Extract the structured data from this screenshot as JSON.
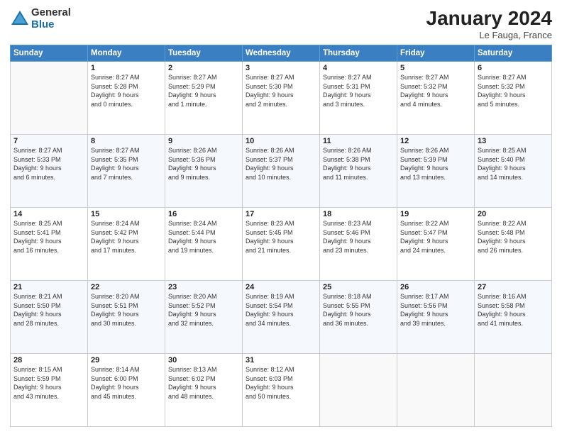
{
  "header": {
    "logo_general": "General",
    "logo_blue": "Blue",
    "month_title": "January 2024",
    "location": "Le Fauga, France"
  },
  "days_of_week": [
    "Sunday",
    "Monday",
    "Tuesday",
    "Wednesday",
    "Thursday",
    "Friday",
    "Saturday"
  ],
  "weeks": [
    [
      {
        "day": "",
        "content": ""
      },
      {
        "day": "1",
        "content": "Sunrise: 8:27 AM\nSunset: 5:28 PM\nDaylight: 9 hours\nand 0 minutes."
      },
      {
        "day": "2",
        "content": "Sunrise: 8:27 AM\nSunset: 5:29 PM\nDaylight: 9 hours\nand 1 minute."
      },
      {
        "day": "3",
        "content": "Sunrise: 8:27 AM\nSunset: 5:30 PM\nDaylight: 9 hours\nand 2 minutes."
      },
      {
        "day": "4",
        "content": "Sunrise: 8:27 AM\nSunset: 5:31 PM\nDaylight: 9 hours\nand 3 minutes."
      },
      {
        "day": "5",
        "content": "Sunrise: 8:27 AM\nSunset: 5:32 PM\nDaylight: 9 hours\nand 4 minutes."
      },
      {
        "day": "6",
        "content": "Sunrise: 8:27 AM\nSunset: 5:32 PM\nDaylight: 9 hours\nand 5 minutes."
      }
    ],
    [
      {
        "day": "7",
        "content": "Sunrise: 8:27 AM\nSunset: 5:33 PM\nDaylight: 9 hours\nand 6 minutes."
      },
      {
        "day": "8",
        "content": "Sunrise: 8:27 AM\nSunset: 5:35 PM\nDaylight: 9 hours\nand 7 minutes."
      },
      {
        "day": "9",
        "content": "Sunrise: 8:26 AM\nSunset: 5:36 PM\nDaylight: 9 hours\nand 9 minutes."
      },
      {
        "day": "10",
        "content": "Sunrise: 8:26 AM\nSunset: 5:37 PM\nDaylight: 9 hours\nand 10 minutes."
      },
      {
        "day": "11",
        "content": "Sunrise: 8:26 AM\nSunset: 5:38 PM\nDaylight: 9 hours\nand 11 minutes."
      },
      {
        "day": "12",
        "content": "Sunrise: 8:26 AM\nSunset: 5:39 PM\nDaylight: 9 hours\nand 13 minutes."
      },
      {
        "day": "13",
        "content": "Sunrise: 8:25 AM\nSunset: 5:40 PM\nDaylight: 9 hours\nand 14 minutes."
      }
    ],
    [
      {
        "day": "14",
        "content": "Sunrise: 8:25 AM\nSunset: 5:41 PM\nDaylight: 9 hours\nand 16 minutes."
      },
      {
        "day": "15",
        "content": "Sunrise: 8:24 AM\nSunset: 5:42 PM\nDaylight: 9 hours\nand 17 minutes."
      },
      {
        "day": "16",
        "content": "Sunrise: 8:24 AM\nSunset: 5:44 PM\nDaylight: 9 hours\nand 19 minutes."
      },
      {
        "day": "17",
        "content": "Sunrise: 8:23 AM\nSunset: 5:45 PM\nDaylight: 9 hours\nand 21 minutes."
      },
      {
        "day": "18",
        "content": "Sunrise: 8:23 AM\nSunset: 5:46 PM\nDaylight: 9 hours\nand 23 minutes."
      },
      {
        "day": "19",
        "content": "Sunrise: 8:22 AM\nSunset: 5:47 PM\nDaylight: 9 hours\nand 24 minutes."
      },
      {
        "day": "20",
        "content": "Sunrise: 8:22 AM\nSunset: 5:48 PM\nDaylight: 9 hours\nand 26 minutes."
      }
    ],
    [
      {
        "day": "21",
        "content": "Sunrise: 8:21 AM\nSunset: 5:50 PM\nDaylight: 9 hours\nand 28 minutes."
      },
      {
        "day": "22",
        "content": "Sunrise: 8:20 AM\nSunset: 5:51 PM\nDaylight: 9 hours\nand 30 minutes."
      },
      {
        "day": "23",
        "content": "Sunrise: 8:20 AM\nSunset: 5:52 PM\nDaylight: 9 hours\nand 32 minutes."
      },
      {
        "day": "24",
        "content": "Sunrise: 8:19 AM\nSunset: 5:54 PM\nDaylight: 9 hours\nand 34 minutes."
      },
      {
        "day": "25",
        "content": "Sunrise: 8:18 AM\nSunset: 5:55 PM\nDaylight: 9 hours\nand 36 minutes."
      },
      {
        "day": "26",
        "content": "Sunrise: 8:17 AM\nSunset: 5:56 PM\nDaylight: 9 hours\nand 39 minutes."
      },
      {
        "day": "27",
        "content": "Sunrise: 8:16 AM\nSunset: 5:58 PM\nDaylight: 9 hours\nand 41 minutes."
      }
    ],
    [
      {
        "day": "28",
        "content": "Sunrise: 8:15 AM\nSunset: 5:59 PM\nDaylight: 9 hours\nand 43 minutes."
      },
      {
        "day": "29",
        "content": "Sunrise: 8:14 AM\nSunset: 6:00 PM\nDaylight: 9 hours\nand 45 minutes."
      },
      {
        "day": "30",
        "content": "Sunrise: 8:13 AM\nSunset: 6:02 PM\nDaylight: 9 hours\nand 48 minutes."
      },
      {
        "day": "31",
        "content": "Sunrise: 8:12 AM\nSunset: 6:03 PM\nDaylight: 9 hours\nand 50 minutes."
      },
      {
        "day": "",
        "content": ""
      },
      {
        "day": "",
        "content": ""
      },
      {
        "day": "",
        "content": ""
      }
    ]
  ]
}
